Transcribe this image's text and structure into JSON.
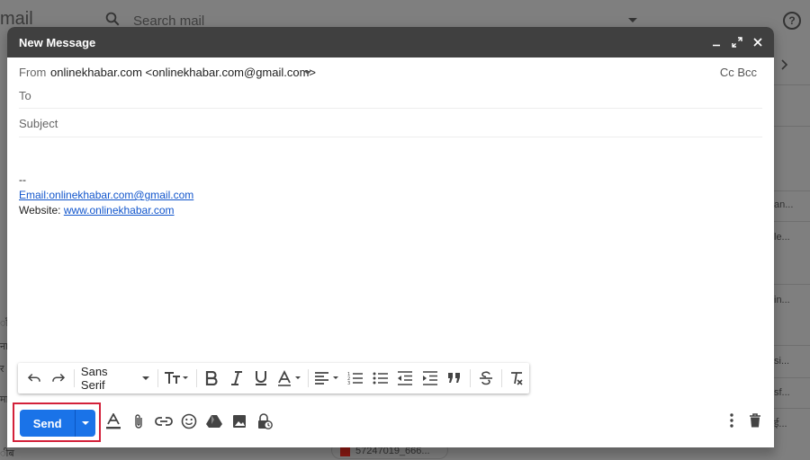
{
  "background": {
    "logo_partial": "mail",
    "search_placeholder": "Search mail",
    "help_glyph": "?",
    "right_snippets": [
      "an...",
      "le...",
      "in...",
      "si...",
      "sf...",
      "ई..."
    ],
    "left_snippets": [
      "ाँ",
      "ना",
      "र",
      "मा",
      "ीब"
    ],
    "attachment_name": "57247019_666..."
  },
  "compose": {
    "title": "New Message",
    "from_label": "From",
    "from_value": "onlinekhabar.com <onlinekhabar.com@gmail.com>",
    "cc_bcc": "Cc Bcc",
    "to_label": "To",
    "subject_placeholder": "Subject",
    "signature": {
      "dashes": "--",
      "email_link": "Email:onlinekhabar.com@gmail.com",
      "website_label": "Website: ",
      "website_link": "www.onlinekhabar.com"
    },
    "font_family": "Sans Serif",
    "send_label": "Send"
  },
  "colors": {
    "send_blue": "#1a73e8",
    "titlebar": "#404040",
    "highlight_red": "#d3213a",
    "link": "#1155cc"
  }
}
